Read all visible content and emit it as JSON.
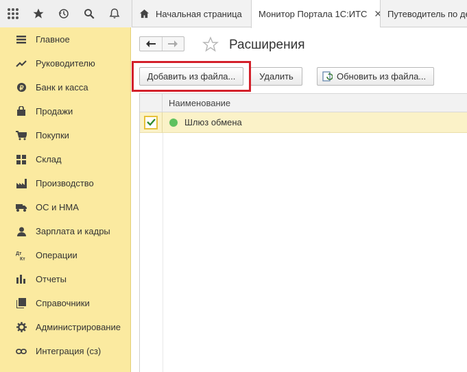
{
  "colors": {
    "sidebar_bg": "#fbeaa0",
    "highlight": "#d3202a",
    "selected_row": "#fbf2c8",
    "status_ok": "#5fc15f"
  },
  "topbar": {
    "icons": [
      "apps-grid-icon",
      "star-icon",
      "history-icon",
      "search-icon",
      "bell-icon"
    ],
    "tabs": [
      {
        "label": "Начальная страница",
        "icon": "home-icon"
      },
      {
        "label": "Монитор Портала 1С:ИТС",
        "close": "✕"
      },
      {
        "label": "Путеводитель по де"
      }
    ]
  },
  "sidebar": {
    "items": [
      {
        "label": "Главное",
        "icon": "menu-lines-icon"
      },
      {
        "label": "Руководителю",
        "icon": "trend-icon"
      },
      {
        "label": "Банк и касса",
        "icon": "coin-icon"
      },
      {
        "label": "Продажи",
        "icon": "bag-icon"
      },
      {
        "label": "Покупки",
        "icon": "cart-icon"
      },
      {
        "label": "Склад",
        "icon": "grid-icon"
      },
      {
        "label": "Производство",
        "icon": "factory-icon"
      },
      {
        "label": "ОС и НМА",
        "icon": "truck-icon"
      },
      {
        "label": "Зарплата и кадры",
        "icon": "person-icon"
      },
      {
        "label": "Операции",
        "icon": "dt-kt-icon"
      },
      {
        "label": "Отчеты",
        "icon": "bar-chart-icon"
      },
      {
        "label": "Справочники",
        "icon": "books-icon"
      },
      {
        "label": "Администрирование",
        "icon": "gear-icon"
      },
      {
        "label": "Интеграция (сз)",
        "icon": "link-icon"
      }
    ]
  },
  "main": {
    "title": "Расширения",
    "buttons": {
      "add": "Добавить из файла...",
      "delete": "Удалить",
      "update": "Обновить из файла..."
    },
    "table": {
      "column": "Наименование",
      "rows": [
        {
          "name": "Шлюз обмена",
          "checked": true,
          "status": "active"
        }
      ]
    }
  }
}
